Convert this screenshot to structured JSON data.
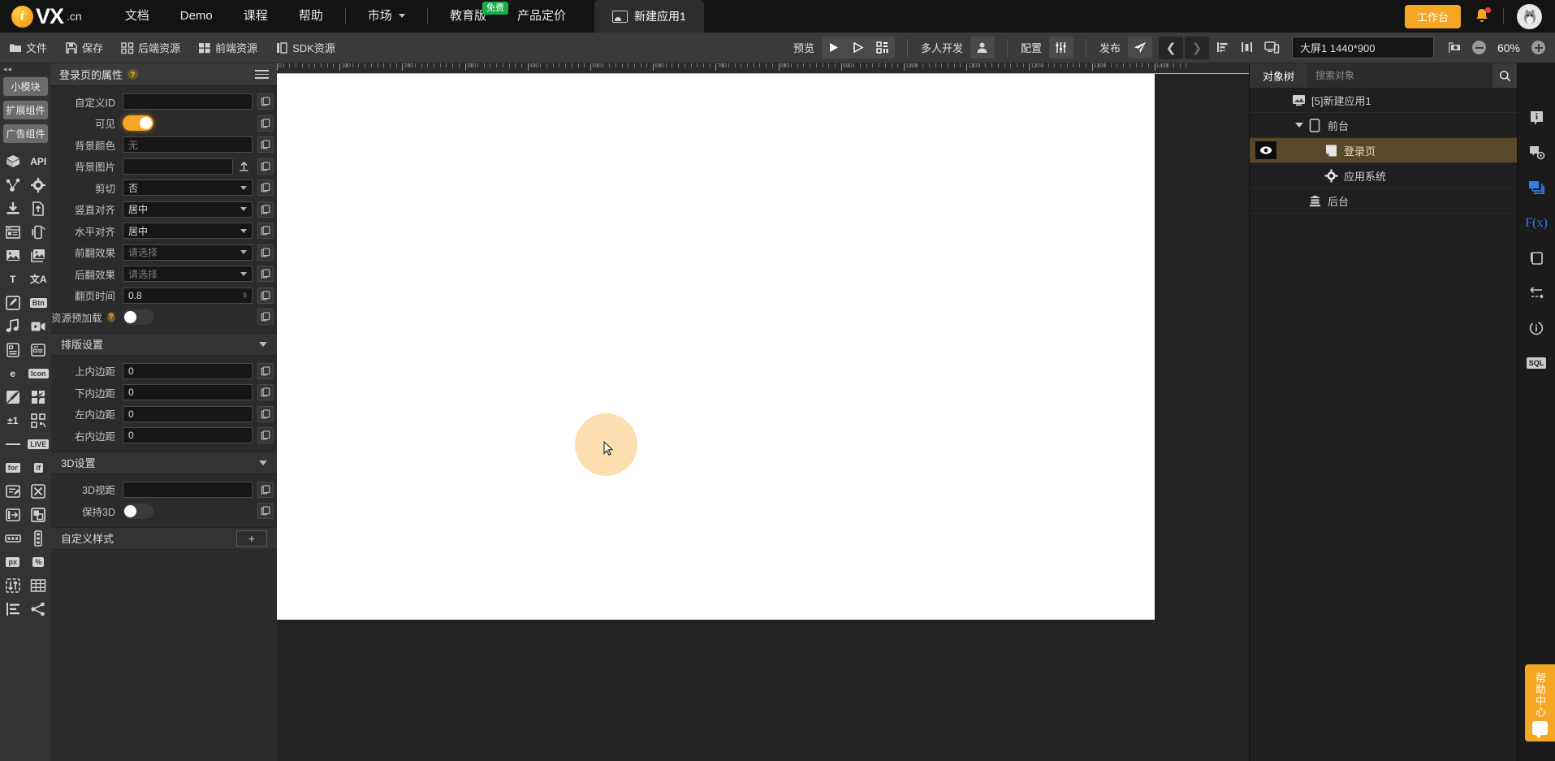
{
  "topnav": {
    "brand": {
      "mark": "i",
      "name": "VX",
      "suffix": ".cn"
    },
    "items": [
      {
        "label": "文档",
        "icon": ""
      },
      {
        "label": "Demo",
        "icon": ""
      },
      {
        "label": "课程",
        "icon": ""
      },
      {
        "label": "帮助",
        "icon": ""
      }
    ],
    "market": {
      "label": "市场",
      "icon": "caret-down-icon"
    },
    "edu": {
      "label": "教育版",
      "badge": "免费"
    },
    "pricing": {
      "label": "产品定价"
    },
    "tab": {
      "label": "新建应用1",
      "icon": "app-window-icon"
    },
    "workbench": "工作台",
    "bell_icon": "bell-icon",
    "avatar_icon": "avatar-icon"
  },
  "toolbar": {
    "file": "文件",
    "save": "保存",
    "backend_res": "后端资源",
    "frontend_res": "前端资源",
    "sdk_res": "SDK资源",
    "preview": "预览",
    "multiuser": "多人开发",
    "config": "配置",
    "publish": "发布",
    "icons": {
      "folder": "folder-icon",
      "save": "floppy-save-icon",
      "backend": "grid-dots-icon",
      "frontend": "grid-blocks-icon",
      "sdk": "columns-icon",
      "play": "play-icon",
      "play_outline": "play-outline-icon",
      "qrcode": "qrcode-icon",
      "user": "user-icon",
      "sliders": "sliders-icon",
      "send": "paper-plane-icon",
      "prev": "chevron-left-icon",
      "next": "chevron-right-icon",
      "align_left": "align-left-icon",
      "align_center": "align-center-icon",
      "responsive": "devices-icon",
      "screenshot": "screenshot-icon"
    },
    "screen_size": "大屏1 1440*900",
    "zoom": "60%",
    "zoom_out_icon": "minus-circle-icon",
    "zoom_in_icon": "plus-circle-icon"
  },
  "rail": {
    "collapse_icon": "collapse-left-icon",
    "buttons": [
      {
        "label": "小模块"
      },
      {
        "label": "扩展组件"
      },
      {
        "label": "广告组件"
      }
    ],
    "icons": [
      {
        "name": "package-icon",
        "kind": "svg"
      },
      {
        "name": "api-text-icon",
        "kind": "text",
        "text": "API"
      },
      {
        "name": "share-nodes-icon",
        "kind": "svg"
      },
      {
        "name": "gear-icon",
        "kind": "svg"
      },
      {
        "name": "download-icon",
        "kind": "svg"
      },
      {
        "name": "file-upload-icon",
        "kind": "svg"
      },
      {
        "name": "browser-window-icon",
        "kind": "svg"
      },
      {
        "name": "mobile-signal-icon",
        "kind": "svg"
      },
      {
        "name": "image-icon",
        "kind": "svg"
      },
      {
        "name": "image-stack-icon",
        "kind": "svg"
      },
      {
        "name": "text-T-icon",
        "kind": "text",
        "text": "T"
      },
      {
        "name": "translate-icon",
        "kind": "text",
        "text": "文A"
      },
      {
        "name": "edit-pencil-icon",
        "kind": "svg"
      },
      {
        "name": "button-icon",
        "kind": "box",
        "text": "Btn"
      },
      {
        "name": "music-note-icon",
        "kind": "svg"
      },
      {
        "name": "video-camera-icon",
        "kind": "svg"
      },
      {
        "name": "form-input-icon",
        "kind": "svg"
      },
      {
        "name": "rich-text-icon",
        "kind": "svg"
      },
      {
        "name": "browser-e-icon",
        "kind": "text",
        "text": "e"
      },
      {
        "name": "icon-circle-icon",
        "kind": "box",
        "text": "Icon"
      },
      {
        "name": "pen-disabled-icon",
        "kind": "svg"
      },
      {
        "name": "paper-plane-pieces-icon",
        "kind": "svg"
      },
      {
        "name": "plusminus-one-icon",
        "kind": "text",
        "text": "±1"
      },
      {
        "name": "qrcode-scan-icon",
        "kind": "svg"
      },
      {
        "name": "divider-line-icon",
        "kind": "svg"
      },
      {
        "name": "live-icon",
        "kind": "box",
        "text": "LIVE"
      },
      {
        "name": "for-loop-icon",
        "kind": "box",
        "text": "for"
      },
      {
        "name": "if-condition-icon",
        "kind": "box",
        "text": "if"
      },
      {
        "name": "form-edit-icon",
        "kind": "svg"
      },
      {
        "name": "shuffle-icon",
        "kind": "svg"
      },
      {
        "name": "slide-in-icon",
        "kind": "svg"
      },
      {
        "name": "layers-icon",
        "kind": "svg"
      },
      {
        "name": "progress-bar-icon",
        "kind": "svg"
      },
      {
        "name": "vertical-list-icon",
        "kind": "svg"
      },
      {
        "name": "px-unit-icon",
        "kind": "box",
        "text": "px"
      },
      {
        "name": "percent-unit-icon",
        "kind": "box",
        "text": "%"
      },
      {
        "name": "sort-updown-icon",
        "kind": "svg"
      },
      {
        "name": "table-grid-icon",
        "kind": "svg"
      },
      {
        "name": "align-list-icon",
        "kind": "svg"
      },
      {
        "name": "share-icon",
        "kind": "svg"
      }
    ]
  },
  "props": {
    "title": "登录页的属性",
    "help_icon": "question-mark-icon",
    "menu_icon": "hamburger-menu-icon",
    "copy_icon": "copy-icon",
    "upload_icon": "upload-icon",
    "rows": [
      {
        "label": "自定义ID",
        "type": "input",
        "value": "",
        "placeholder": ""
      },
      {
        "label": "可见",
        "type": "toggle",
        "state": "on"
      },
      {
        "label": "背景颜色",
        "type": "input",
        "value": "",
        "placeholder": "无"
      },
      {
        "label": "背景图片",
        "type": "upload",
        "value": "",
        "placeholder": ""
      },
      {
        "label": "剪切",
        "type": "select",
        "value": "否"
      },
      {
        "label": "竖直对齐",
        "type": "select",
        "value": "居中"
      },
      {
        "label": "水平对齐",
        "type": "select",
        "value": "居中"
      },
      {
        "label": "前翻效果",
        "type": "select",
        "value": "",
        "placeholder": "请选择"
      },
      {
        "label": "后翻效果",
        "type": "select",
        "value": "",
        "placeholder": "请选择"
      },
      {
        "label": "翻页时间",
        "type": "input",
        "value": "0.8",
        "unit": "s"
      },
      {
        "label": "资源预加载",
        "type": "toggle",
        "state": "off",
        "help": true
      }
    ],
    "section_layout": {
      "title": "排版设置",
      "collapsed": false
    },
    "layout_rows": [
      {
        "label": "上内边距",
        "type": "input",
        "value": "0"
      },
      {
        "label": "下内边距",
        "type": "input",
        "value": "0"
      },
      {
        "label": "左内边距",
        "type": "input",
        "value": "0"
      },
      {
        "label": "右内边距",
        "type": "input",
        "value": "0"
      }
    ],
    "section_3d": {
      "title": "3D设置",
      "collapsed": false
    },
    "threed_rows": [
      {
        "label": "3D视距",
        "type": "input",
        "value": ""
      },
      {
        "label": "保持3D",
        "type": "toggle",
        "state": "off"
      }
    ],
    "section_custom": {
      "title": "自定义样式",
      "add": "+"
    }
  },
  "canvas": {
    "ruler_labels": [
      "0",
      "100",
      "200",
      "300",
      "400",
      "500",
      "600",
      "700",
      "800",
      "900",
      "1000",
      "1100",
      "1200",
      "1300",
      "1400"
    ],
    "click_indicator": {
      "visible": true
    },
    "cursor_icon": "mouse-pointer-icon"
  },
  "tree": {
    "tab_label": "对象树",
    "search_placeholder": "搜索对象",
    "search_value": "",
    "search_icon": "search-icon",
    "nodes": [
      {
        "label": "[5]新建应用1",
        "icon": "app-window-icon",
        "depth": 0,
        "selected": false,
        "expander": false,
        "eye": false
      },
      {
        "label": "前台",
        "icon": "mobile-icon",
        "depth": 1,
        "selected": false,
        "expander": true,
        "eye": false
      },
      {
        "label": "登录页",
        "icon": "page-icon",
        "depth": 2,
        "selected": true,
        "expander": false,
        "eye": true
      },
      {
        "label": "应用系统",
        "icon": "gear-icon",
        "depth": 2,
        "selected": false,
        "expander": false,
        "eye": false
      },
      {
        "label": "后台",
        "icon": "server-icon",
        "depth": 1,
        "selected": false,
        "expander": false,
        "eye": false
      }
    ]
  },
  "strip": {
    "icons": [
      {
        "name": "info-bubble-icon",
        "accent": false
      },
      {
        "name": "bubble-gear-icon",
        "accent": false
      },
      {
        "name": "bubble-stack-icon",
        "accent": true
      },
      {
        "name": "function-fx-icon",
        "accent": true,
        "text": "F(x)"
      },
      {
        "name": "copy-object-icon",
        "accent": false
      },
      {
        "name": "data-flow-icon",
        "accent": false
      },
      {
        "name": "history-icon",
        "accent": false
      },
      {
        "name": "sql-icon",
        "accent": false,
        "text": "SQL"
      }
    ],
    "help": {
      "label": "帮助中心",
      "q": "?"
    }
  },
  "colors": {
    "accent": "#f5a623",
    "selected_row": "#59492a",
    "blue": "#2f7fe8",
    "green": "#1aad4b",
    "ruler_line": "#4ad8e8"
  }
}
